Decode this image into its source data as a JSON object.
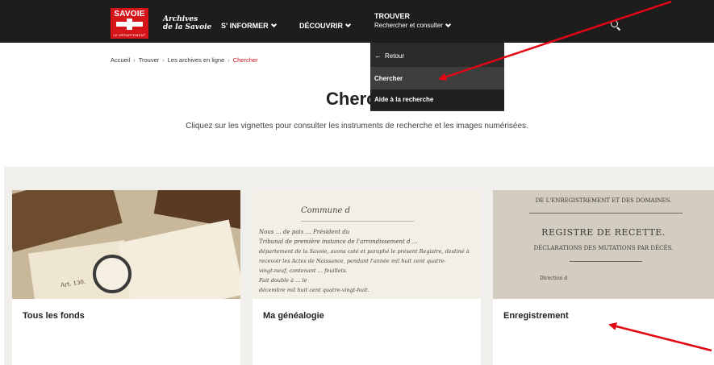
{
  "header": {
    "logo_word": "SAVOIE",
    "logo_sub": "LE DÉPARTEMENT",
    "brand_line1": "Archives",
    "brand_line2": "de la Savoie",
    "nav": {
      "informer": "S' INFORMER",
      "decouvrir": "DÉCOUVRIR",
      "trouver_main": "TROUVER",
      "trouver_sub": "Rechercher et consulter"
    }
  },
  "dropdown": {
    "back": "Retour",
    "search": "Chercher",
    "help": "Aide à la recherche"
  },
  "breadcrumb": {
    "home": "Accueil",
    "trouver": "Trouver",
    "archives": "Les archives en ligne",
    "current": "Chercher",
    "separator": "›"
  },
  "page": {
    "title": "Cherc",
    "subtitle": "Cliquez sur les vignettes pour consulter les instruments de recherche et les images numérisées."
  },
  "cards": [
    {
      "title": "Tous les fonds"
    },
    {
      "title": "Ma généalogie"
    },
    {
      "title": "Enregistrement"
    }
  ],
  "thumbnails": {
    "genealogy": {
      "commune": "Commune d",
      "line1": "Nous … de paix … Président du",
      "line2": "Tribunal de première instance de l'arrondissement d …",
      "line3": "département de la Savoie, avons coté et paraphé le présent Registre, destiné à",
      "line4": "recevoir les Actes de Naissance, pendant l'année mil huit cent quatre-",
      "line5": "vingt-neuf, contenant … feuillets.",
      "line6": "Fait double à … le",
      "line7": "décembre mil huit cent quatre-vingt-huit."
    },
    "register": {
      "line1": "DE L'ENREGISTREMENT ET DES DOMAINES.",
      "line2": "REGISTRE DE RECETTE.",
      "line3": "DÉCLARATIONS DES MUTATIONS PAR DÉCÈS.",
      "line4": "Direction d"
    },
    "book": {
      "caption": "Art. 130."
    }
  },
  "colors": {
    "topbar": "#1d1d1d",
    "brand_red": "#d6151b",
    "section_bg": "#f0efec",
    "annotation": "#e30613"
  }
}
